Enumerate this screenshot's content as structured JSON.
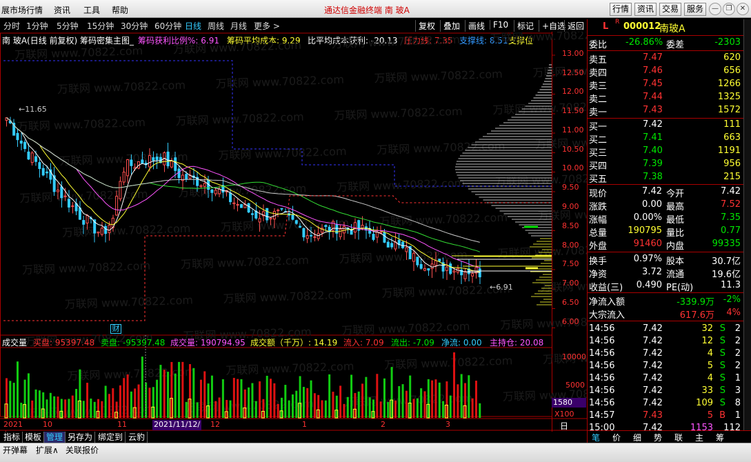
{
  "topbar": {
    "menus": [
      "展市场行情",
      "资讯",
      "工具",
      "帮助"
    ],
    "title": "通达信金融终端  南 玻A",
    "buttons": [
      "行情",
      "资讯",
      "交易",
      "服务"
    ],
    "window": [
      "minimize",
      "restore",
      "close"
    ]
  },
  "periods": {
    "items": [
      "分时",
      "1分钟",
      "5分钟",
      "15分钟",
      "30分钟",
      "60分钟",
      "日线",
      "周线",
      "月线",
      "更多 >"
    ],
    "selected": "日线",
    "tools": [
      "复权",
      "叠加",
      "画线",
      "F10",
      "标记",
      "+自选",
      "返回"
    ]
  },
  "ind1": {
    "name": "南 玻A(日线 前复权) 筹码密集主图_",
    "ratio": "筹码获利比例%: 6.91",
    "avgcost": "筹码平均成本: 9.29",
    "avgprofit": "比平均成本获利: -20.13",
    "pressure": "压力线: 7.35",
    "support": "支撑线: 8.51",
    "support2": "支撑位"
  },
  "main_axis": [
    "13.00",
    "12.50",
    "12.00",
    "11.50",
    "11.00",
    "10.50",
    "10.00",
    "9.50",
    "9.00",
    "8.50",
    "8.00",
    "7.50",
    "7.00",
    "6.50",
    "6.00"
  ],
  "annotations": {
    "high": "11.65",
    "low": "6.91",
    "cai": "财"
  },
  "ind2": {
    "name": "成交量",
    "buy": "买盘: 95397.48",
    "sell": "卖盘: -95397.48",
    "vol": "成交量: 190794.95",
    "amt": "成交额（千万）: 14.19",
    "in": "流入: 7.09",
    "out": "流出: -7.09",
    "net": "净流: 0.00",
    "main": "主持仓: 20.08"
  },
  "vol_axis": [
    "10000",
    "5000",
    "X100"
  ],
  "vol_current": "1580",
  "date_axis": {
    "year": "2021年",
    "labels": [
      "10",
      "11",
      "12",
      "1",
      "2",
      "3"
    ],
    "cursor": "2021/11/12/五"
  },
  "date_axis_right": "日线",
  "bottom_tabs": [
    "指标",
    "模板",
    "管理",
    "另存为",
    "绑定到",
    "云豹"
  ],
  "status": [
    "开弹幕",
    "扩展∧",
    "关联报价"
  ],
  "watermark": "万联网 www.70822.com",
  "quote": {
    "code": "000012",
    "name": "南玻A",
    "flag": "L",
    "weibi_label": "委比",
    "weibi": "-26.86%",
    "weicha_label": "委差",
    "weicha": "-2303",
    "asks": [
      {
        "l": "卖五",
        "p": "7.47",
        "v": "620"
      },
      {
        "l": "卖四",
        "p": "7.46",
        "v": "656"
      },
      {
        "l": "卖三",
        "p": "7.45",
        "v": "1266"
      },
      {
        "l": "卖二",
        "p": "7.44",
        "v": "1325"
      },
      {
        "l": "卖一",
        "p": "7.43",
        "v": "1572"
      }
    ],
    "bids": [
      {
        "l": "买一",
        "p": "7.42",
        "v": "111"
      },
      {
        "l": "买二",
        "p": "7.41",
        "v": "663"
      },
      {
        "l": "买三",
        "p": "7.40",
        "v": "1191"
      },
      {
        "l": "买四",
        "p": "7.39",
        "v": "956"
      },
      {
        "l": "买五",
        "p": "7.38",
        "v": "215"
      }
    ],
    "stats": [
      {
        "l1": "现价",
        "v1": "7.42",
        "l2": "今开",
        "v2": "7.42"
      },
      {
        "l1": "涨跌",
        "v1": "0.00",
        "l2": "最高",
        "v2": "7.52"
      },
      {
        "l1": "涨幅",
        "v1": "0.00%",
        "l2": "最低",
        "v2": "7.35"
      },
      {
        "l1": "总量",
        "v1": "190795",
        "l2": "量比",
        "v2": "0.77"
      },
      {
        "l1": "外盘",
        "v1": "91460",
        "l2": "内盘",
        "v2": "99335"
      }
    ],
    "stats2": [
      {
        "l1": "换手",
        "v1": "0.97%",
        "l2": "股本",
        "v2": "30.7亿"
      },
      {
        "l1": "净资",
        "v1": "3.72",
        "l2": "流通",
        "v2": "19.6亿"
      },
      {
        "l1": "收益(三)",
        "v1": "0.490",
        "l2": "PE(动)",
        "v2": "11.3"
      }
    ],
    "flow": [
      {
        "l": "净流入额",
        "v": "-339.9万",
        "p": "-2%"
      },
      {
        "l": "大宗流入",
        "v": "617.6万",
        "p": "4%"
      }
    ],
    "ticks": [
      {
        "t": "14:56",
        "p": "7.42",
        "v": "32",
        "s": "S",
        "n": "2"
      },
      {
        "t": "14:56",
        "p": "7.42",
        "v": "12",
        "s": "S",
        "n": "2"
      },
      {
        "t": "14:56",
        "p": "7.42",
        "v": "4",
        "s": "S",
        "n": "2"
      },
      {
        "t": "14:56",
        "p": "7.42",
        "v": "5",
        "s": "S",
        "n": "2"
      },
      {
        "t": "14:56",
        "p": "7.42",
        "v": "4",
        "s": "S",
        "n": "1"
      },
      {
        "t": "14:56",
        "p": "7.42",
        "v": "33",
        "s": "S",
        "n": "3"
      },
      {
        "t": "14:56",
        "p": "7.42",
        "v": "109",
        "s": "S",
        "n": "8"
      },
      {
        "t": "14:57",
        "p": "7.43",
        "v": "5",
        "s": "B",
        "n": "1"
      },
      {
        "t": "15:00",
        "p": "7.42",
        "v": "1153",
        "s": "",
        "n": "112"
      }
    ],
    "tabs": [
      "笔",
      "价",
      "细",
      "势",
      "联",
      "主",
      "筹"
    ]
  },
  "colors": {
    "up": "#ff3232",
    "down": "#00e600",
    "ma5": "#ffffff",
    "ma10": "#ffff33",
    "ma20": "#ff55ff",
    "ma60": "#33dd33",
    "ma120": "#cccccc",
    "panel_border": "#aa0000"
  }
}
